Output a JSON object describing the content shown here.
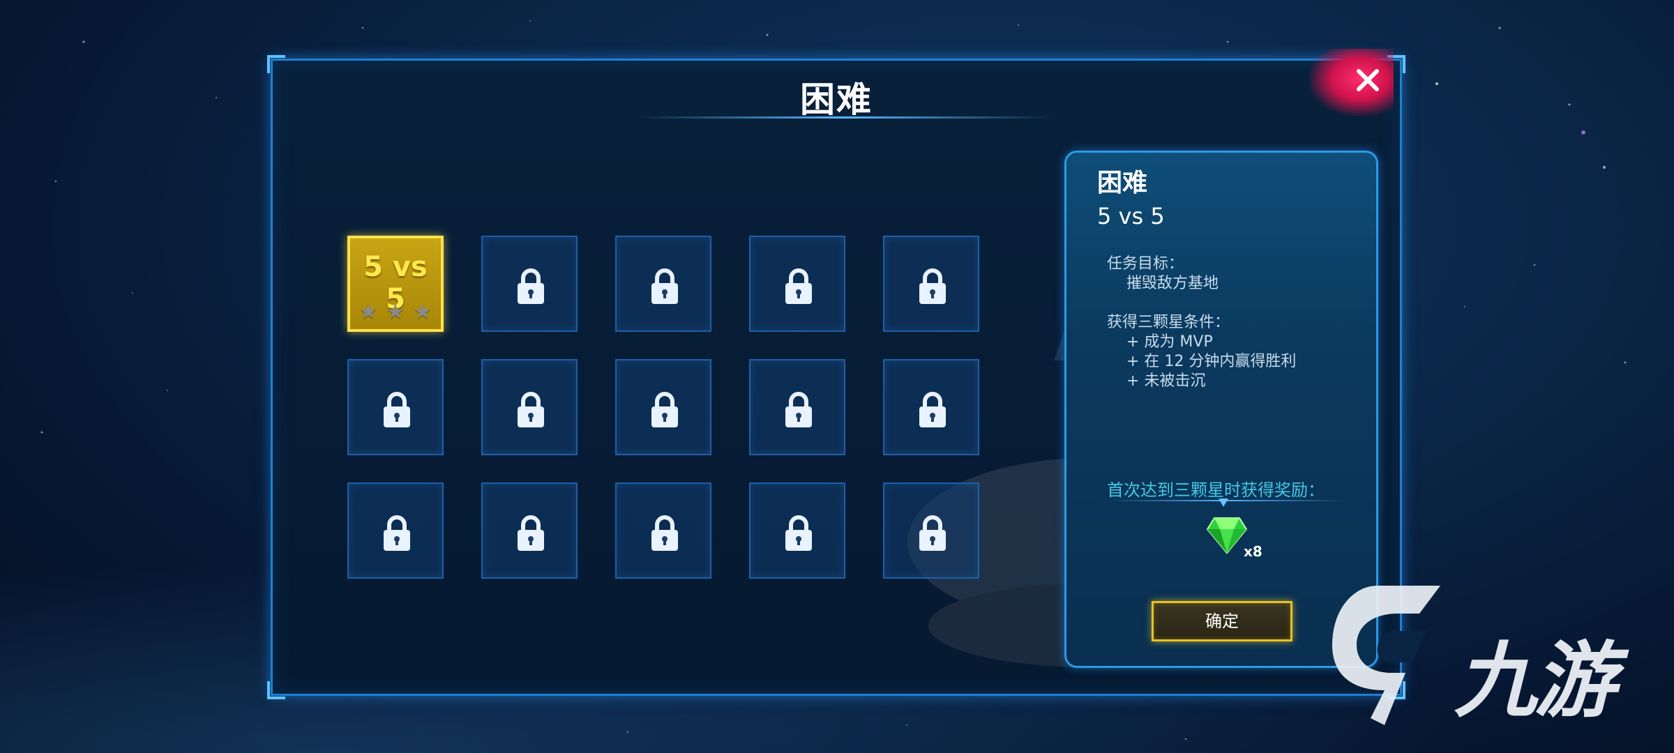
{
  "dialog": {
    "title": "困难",
    "close_icon": "close-icon"
  },
  "levels": [
    {
      "label": "5 vs 5",
      "stars": 3,
      "earned_stars": 0,
      "locked": false,
      "selected": true
    },
    {
      "locked": true
    },
    {
      "locked": true
    },
    {
      "locked": true
    },
    {
      "locked": true
    },
    {
      "locked": true
    },
    {
      "locked": true
    },
    {
      "locked": true
    },
    {
      "locked": true
    },
    {
      "locked": true
    },
    {
      "locked": true
    },
    {
      "locked": true
    },
    {
      "locked": true
    },
    {
      "locked": true
    },
    {
      "locked": true
    }
  ],
  "info": {
    "difficulty": "困难",
    "mode": "5 vs 5",
    "objective_label": "任务目标：",
    "objective": "摧毁敌方基地",
    "condition_label": "获得三颗星条件：",
    "conditions": [
      "+ 成为 MVP",
      "+ 在 12 分钟内赢得胜利",
      "+ 未被击沉"
    ],
    "reward_label": "首次达到三颗星时获得奖励：",
    "reward_icon": "green-gem-icon",
    "reward_count": "x8",
    "confirm_label": "确定"
  },
  "watermark": {
    "text": "九游",
    "logo": "9game-logo-icon"
  },
  "colors": {
    "accent": "#1f7fd4",
    "selected": "#c9a414",
    "close": "#d0134c",
    "reward_text": "#44c8e6",
    "confirm_border": "#e7c221"
  }
}
